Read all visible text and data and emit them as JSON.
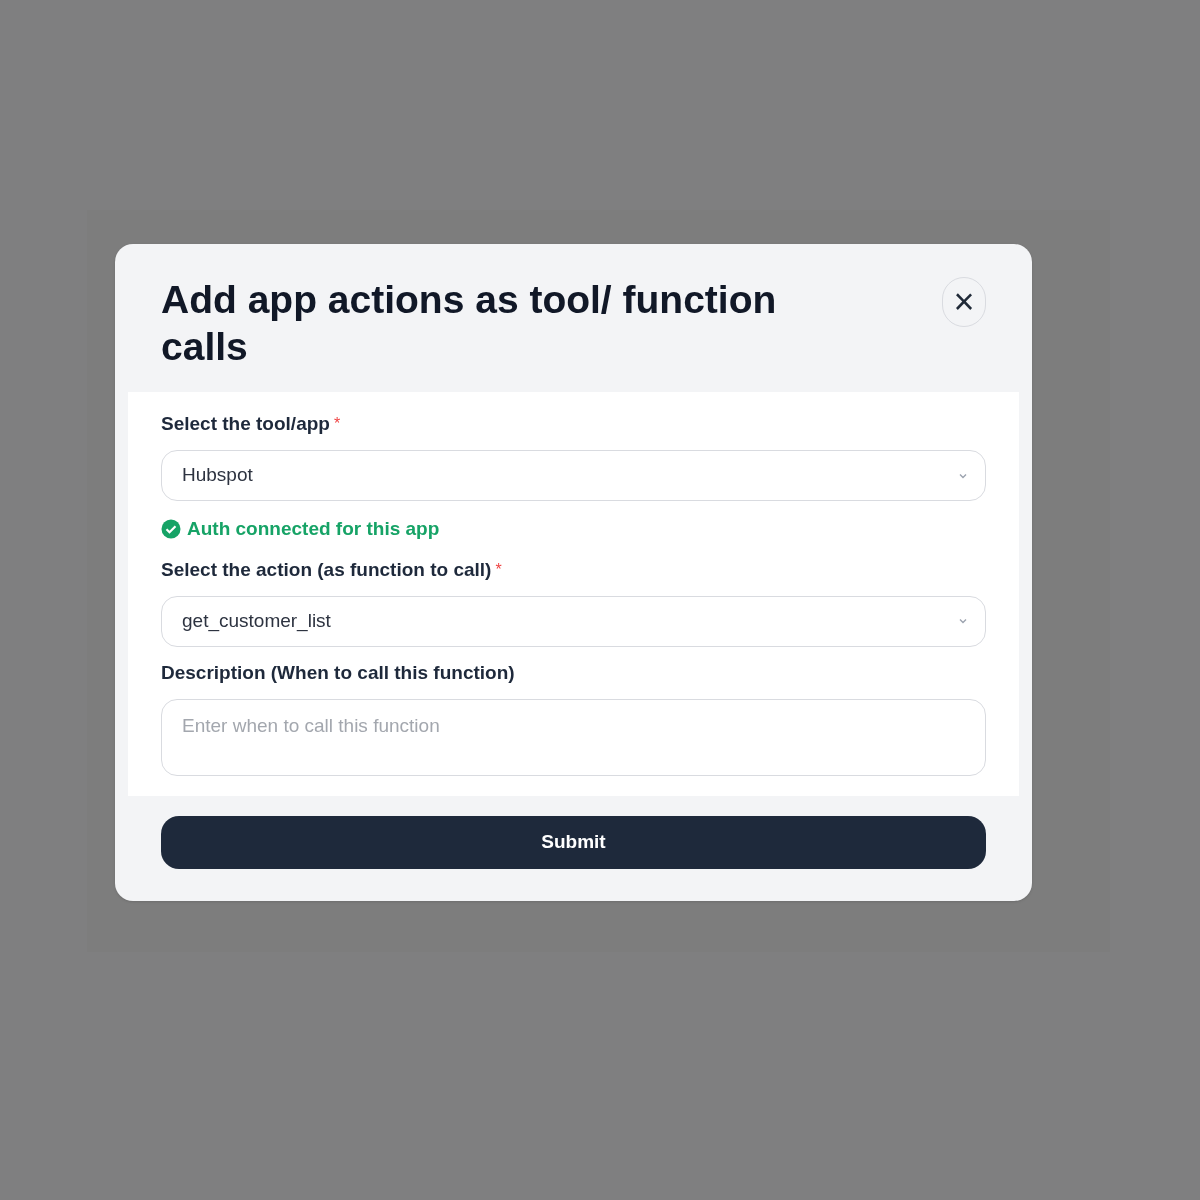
{
  "dialog": {
    "title": "Add app actions as tool/ function calls",
    "close_symbol": "×",
    "fields": [
      {
        "kind": "select",
        "label": "Select the tool/app",
        "required": true,
        "value": "Hubspot",
        "status": {
          "text": "Auth connected for this app",
          "ok": true
        }
      },
      {
        "kind": "select",
        "label": "Select the action (as function to call)",
        "required": true,
        "value": "get_customer_list"
      },
      {
        "kind": "textarea",
        "label": "Description (When to call this function)",
        "required": false,
        "placeholder": "Enter when to call this function"
      }
    ],
    "required_mark": "*",
    "submit": "Submit"
  }
}
